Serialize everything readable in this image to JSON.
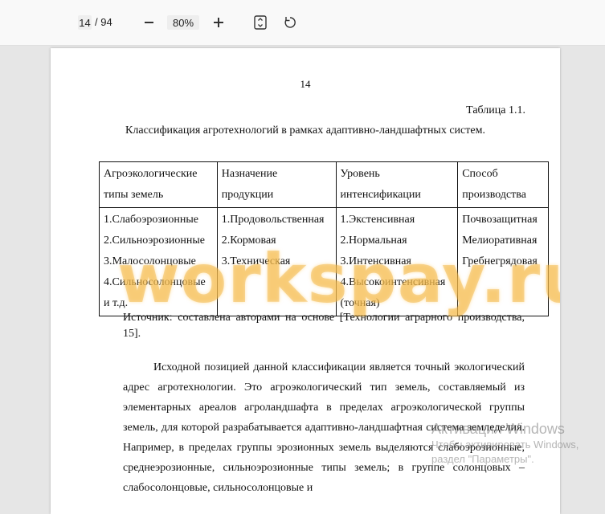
{
  "toolbar": {
    "current_page": "14",
    "total_pages": "/ 94",
    "zoom": "80%",
    "zoom_out_icon": "minus-icon",
    "zoom_in_icon": "plus-icon",
    "fit_icon": "fit-page-icon",
    "rotate_icon": "rotate-icon"
  },
  "page": {
    "number": "14",
    "table_label": "Таблица 1.1.",
    "table_title": "Классификация агротехнологий в рамках адаптивно-ландшафтных систем.",
    "table": {
      "headers": [
        [
          "Агроэкологические",
          "типы земель"
        ],
        [
          "Назначение",
          "продукции"
        ],
        [
          "Уровень",
          "интенсификации"
        ],
        [
          "Способ",
          "производства"
        ]
      ],
      "row": [
        [
          "1.Слабоэрозионные",
          "2.Сильноэрозионные",
          "3.Малосолонцовые",
          "4.Сильносолонцовые",
          "и т.д."
        ],
        [
          "1.Продовольственная",
          "2.Кормовая",
          "3.Техническая"
        ],
        [
          "1.Экстенсивная",
          "2.Нормальная",
          "3.Интенсивная",
          "4.Высокоинтенсивная",
          "(точная)"
        ],
        [
          "Почвозащитная",
          "Мелиоративная",
          "Гребнегрядовая"
        ]
      ]
    },
    "source": "Источник: составлена авторами на основе [Технологии аграрного производства, 15].",
    "paragraph": "Исходной позицией данной классификации является точный экологический адрес агротехнологии. Это агроэкологический тип земель, составляемый из элементарных ареалов агроландшафта в пределах агроэкологической группы земель, для которой разрабатывается адаптивно-ландшафтная система земледелия. Например, в пределах группы эрозионных земель выделяются слабоэрозионные, среднеэрозионные, сильноэрозионные типы земель; в группе солонцовых – слабосолонцовые, сильносолонцовые и"
  },
  "overlay": {
    "watermark": "workspay.ru",
    "activate_title": "Активация Windows",
    "activate_line1": "Чтобы активировать Windows,",
    "activate_line2": "раздел \"Параметры\"."
  }
}
